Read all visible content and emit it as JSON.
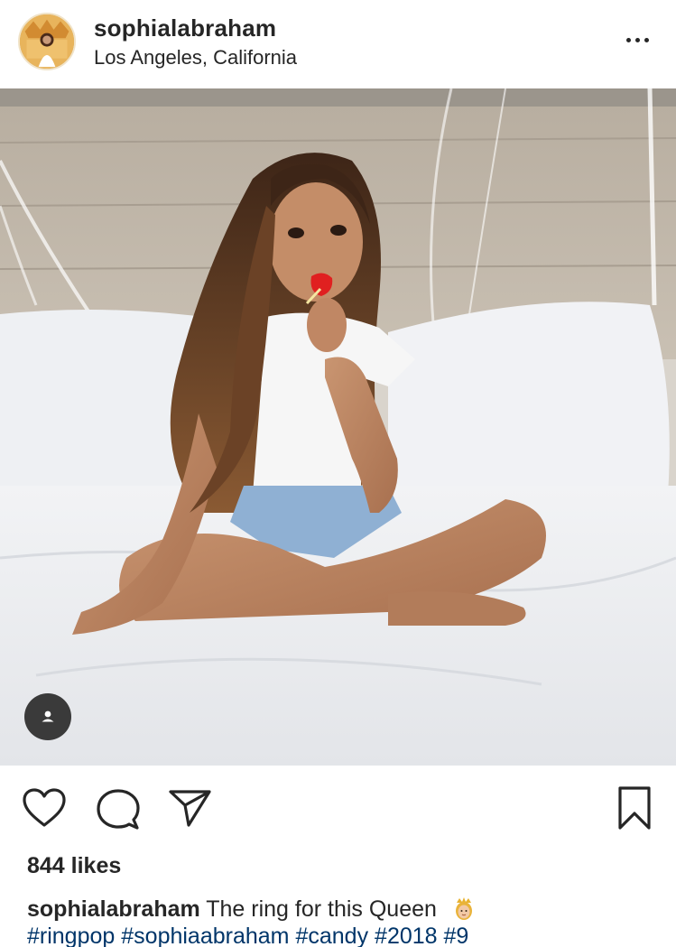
{
  "header": {
    "username": "sophialabraham",
    "location": "Los Angeles, California",
    "avatar_icon": "profile-avatar-crown-logo",
    "more_icon": "more-options-icon"
  },
  "photo": {
    "tag_icon": "user-tag-icon"
  },
  "actions": {
    "like_icon": "heart-icon",
    "comment_icon": "comment-bubble-icon",
    "share_icon": "paper-plane-icon",
    "save_icon": "bookmark-icon"
  },
  "likes": "844 likes",
  "caption": {
    "username": "sophialabraham",
    "text": "The ring for this Queen",
    "emoji": "princess-emoji",
    "hashtags": [
      "#ringpop",
      "#sophiaabraham",
      "#candy",
      "#2018",
      "#9"
    ]
  },
  "colors": {
    "text": "#262626",
    "hashtag": "#003569",
    "tag_badge": "#3a3a3a"
  }
}
